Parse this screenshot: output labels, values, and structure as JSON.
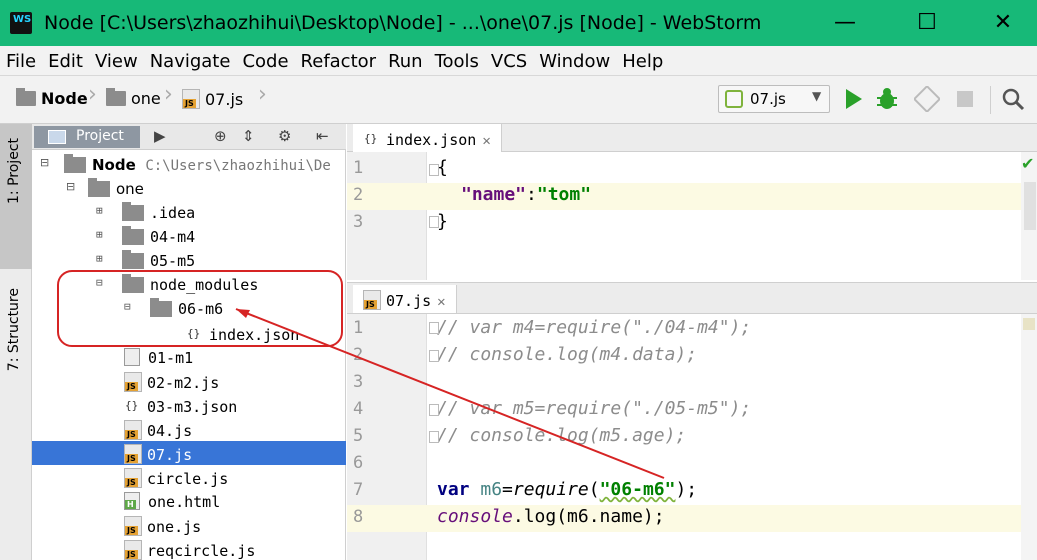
{
  "window": {
    "title": "Node [C:\\Users\\zhaozhihui\\Desktop\\Node] - ...\\one\\07.js [Node] - WebStorm",
    "minimize": "—",
    "maximize": "☐",
    "close": "✕"
  },
  "menu": [
    "File",
    "Edit",
    "View",
    "Navigate",
    "Code",
    "Refactor",
    "Run",
    "Tools",
    "VCS",
    "Window",
    "Help"
  ],
  "breadcrumb": [
    "Node",
    "one",
    "07.js"
  ],
  "run_config": "07.js",
  "tool_strip": {
    "project": "1: Project",
    "structure": "7: Structure"
  },
  "project_panel": {
    "tab": "Project",
    "root": {
      "name": "Node",
      "path": "C:\\Users\\zhaozhihui\\De"
    },
    "items": [
      {
        "label": "one",
        "type": "folder",
        "expanded": true
      },
      {
        "label": ".idea",
        "type": "folder"
      },
      {
        "label": "04-m4",
        "type": "folder"
      },
      {
        "label": "05-m5",
        "type": "folder"
      },
      {
        "label": "node_modules",
        "type": "folder",
        "expanded": true
      },
      {
        "label": "06-m6",
        "type": "folder",
        "expanded": true
      },
      {
        "label": "index.json",
        "type": "json"
      },
      {
        "label": "01-m1",
        "type": "text"
      },
      {
        "label": "02-m2.js",
        "type": "js"
      },
      {
        "label": "03-m3.json",
        "type": "json"
      },
      {
        "label": "04.js",
        "type": "js"
      },
      {
        "label": "07.js",
        "type": "js",
        "selected": true
      },
      {
        "label": "circle.js",
        "type": "js"
      },
      {
        "label": "one.html",
        "type": "html"
      },
      {
        "label": "one.js",
        "type": "js"
      },
      {
        "label": "reqcircle.js",
        "type": "js"
      }
    ]
  },
  "editor1": {
    "tab": "index.json",
    "lines": [
      {
        "n": "1",
        "code": "{"
      },
      {
        "n": "2",
        "key": "\"name\"",
        "sep": ":",
        "val": "\"tom\""
      },
      {
        "n": "3",
        "code": "}"
      }
    ]
  },
  "editor2": {
    "tab": "07.js",
    "lines": [
      {
        "n": "1",
        "comment": "// var m4=require(\"./04-m4\");"
      },
      {
        "n": "2",
        "comment": "// console.log(m4.data);"
      },
      {
        "n": "3"
      },
      {
        "n": "4",
        "comment": "// var m5=require(\"./05-m5\");"
      },
      {
        "n": "5",
        "comment": "// console.log(m5.age);"
      },
      {
        "n": "6"
      },
      {
        "n": "7",
        "kw": "var",
        "v": "m6",
        "eq": "=",
        "fn": "require",
        "p1": "(",
        "str": "\"06-m6\"",
        "p2": ");"
      },
      {
        "n": "8",
        "obj": "console",
        "rest": ".log(m6.name);"
      }
    ]
  },
  "colors": {
    "titlebar": "#17b978",
    "selection": "#3875d7",
    "annotation": "#d62424"
  }
}
